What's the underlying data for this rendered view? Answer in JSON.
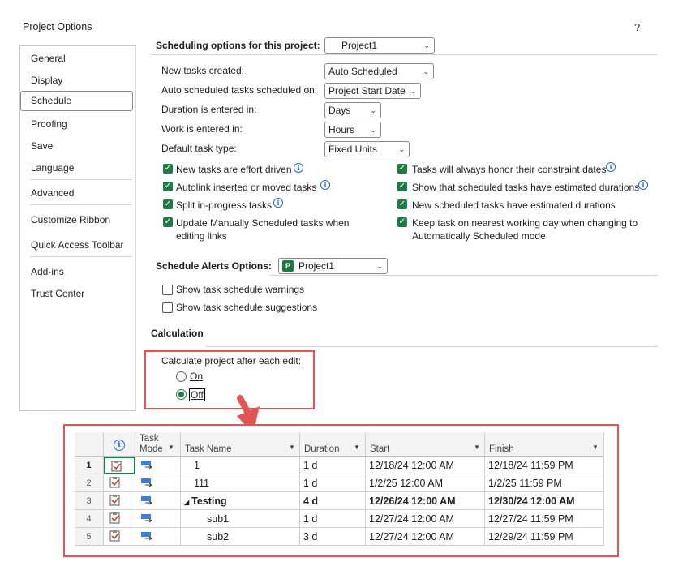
{
  "dialog": {
    "title": "Project Options",
    "help": "?"
  },
  "sidebar": {
    "items": [
      "General",
      "Display",
      "Schedule",
      "Proofing",
      "Save",
      "Language",
      "Advanced",
      "Customize Ribbon",
      "Quick Access Toolbar",
      "Add-ins",
      "Trust Center"
    ],
    "selected": "Schedule"
  },
  "scheduling": {
    "header_label": "Scheduling options for this project:",
    "header_project": "Project1",
    "new_tasks_label": "New tasks created:",
    "new_tasks_value": "Auto Scheduled",
    "auto_sched_label": "Auto scheduled tasks scheduled on:",
    "auto_sched_value": "Project Start Date",
    "duration_label": "Duration is entered in:",
    "duration_value": "Days",
    "work_label": "Work is entered in:",
    "work_value": "Hours",
    "task_type_label": "Default task type:",
    "task_type_value": "Fixed Units",
    "left_checks": [
      {
        "label": "New tasks are effort driven",
        "checked": true,
        "info": true
      },
      {
        "label": "Autolink inserted or moved tasks",
        "checked": true,
        "info": true
      },
      {
        "label": "Split in-progress tasks",
        "checked": true,
        "info": true
      },
      {
        "label": "Update Manually Scheduled tasks when",
        "label2": "editing links",
        "checked": true,
        "info": false
      }
    ],
    "right_checks": [
      {
        "label": "Tasks will always honor their constraint dates",
        "checked": true,
        "info": true
      },
      {
        "label": "Show that scheduled tasks have estimated durations",
        "checked": true,
        "info": true
      },
      {
        "label": "New scheduled tasks have estimated durations",
        "checked": true,
        "info": false
      },
      {
        "label": "Keep task on nearest working day when changing to",
        "label2": "Automatically Scheduled mode",
        "checked": true,
        "info": false
      }
    ]
  },
  "alerts": {
    "label": "Schedule Alerts Options:",
    "project": "Project1",
    "warnings": "Show task schedule warnings",
    "suggestions": "Show task schedule suggestions"
  },
  "calculation": {
    "title": "Calculation",
    "prompt": "Calculate project after each edit:",
    "on_label": "On",
    "off_label": "Off",
    "selected": "Off"
  },
  "grid": {
    "headers": {
      "task_mode_1": "Task",
      "task_mode_2": "Mode",
      "task_name": "Task Name",
      "duration": "Duration",
      "start": "Start",
      "finish": "Finish"
    },
    "rows": [
      {
        "id": "1",
        "name": "1",
        "duration": "1 d",
        "start": "12/18/24 12:00 AM",
        "finish": "12/18/24 11:59 PM",
        "bold": false,
        "indent": 1
      },
      {
        "id": "2",
        "name": "111",
        "duration": "1 d",
        "start": "1/2/25 12:00 AM",
        "finish": "1/2/25 11:59 PM",
        "bold": false,
        "indent": 1
      },
      {
        "id": "3",
        "name": "Testing",
        "duration": "4 d",
        "start": "12/26/24 12:00 AM",
        "finish": "12/30/24 12:00 AM",
        "bold": true,
        "indent": 0
      },
      {
        "id": "4",
        "name": "sub1",
        "duration": "1 d",
        "start": "12/27/24 12:00 AM",
        "finish": "12/27/24 11:59 PM",
        "bold": false,
        "indent": 2
      },
      {
        "id": "5",
        "name": "sub2",
        "duration": "3 d",
        "start": "12/27/24 12:00 AM",
        "finish": "12/29/24 11:59 PM",
        "bold": false,
        "indent": 2
      }
    ]
  },
  "colors": {
    "accent_green": "#1e7b45",
    "highlight_red": "#e05555",
    "info_blue": "#2266cc"
  }
}
